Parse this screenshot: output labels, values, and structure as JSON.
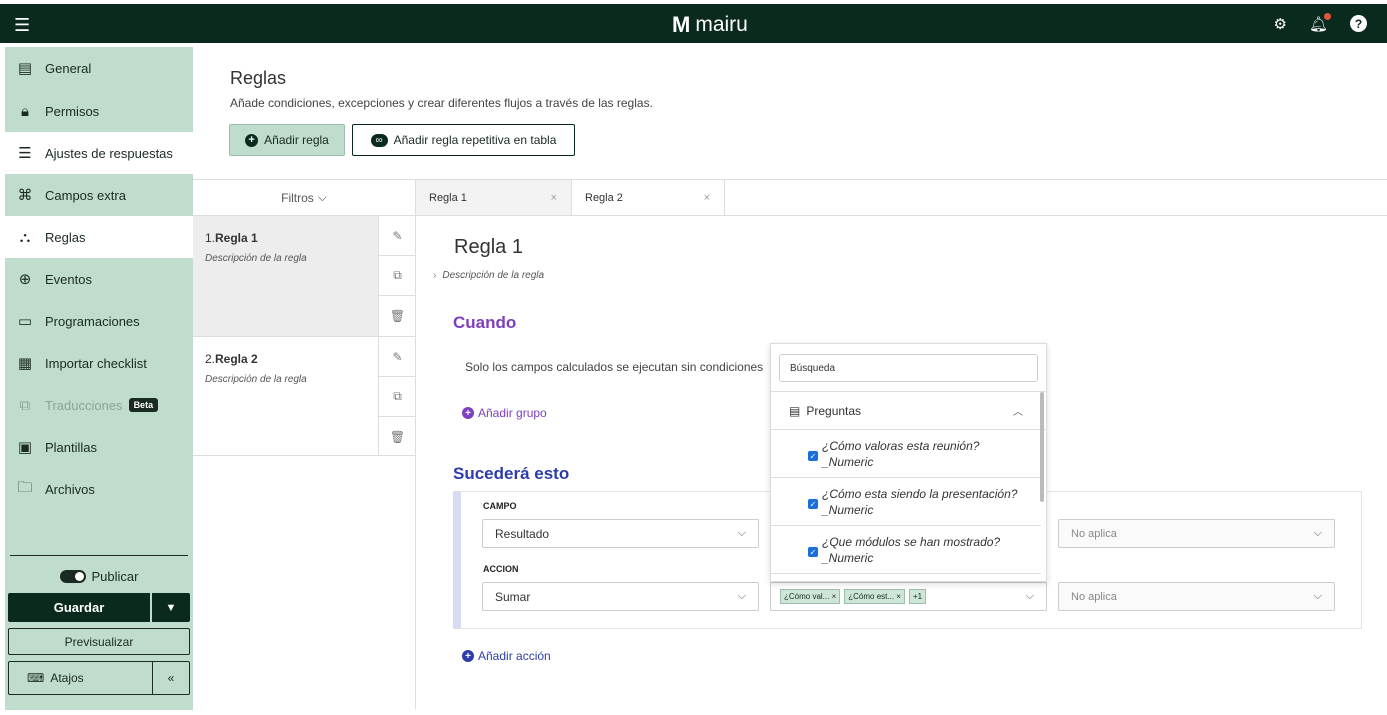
{
  "app": {
    "name": "mairu"
  },
  "sidebar": {
    "items": [
      {
        "label": "General",
        "icon": "document-icon"
      },
      {
        "label": "Permisos",
        "icon": "lock-icon"
      },
      {
        "label": "Ajustes de respuestas",
        "icon": "sliders-icon"
      },
      {
        "label": "Campos extra",
        "icon": "command-icon"
      },
      {
        "label": "Reglas",
        "icon": "hierarchy-icon"
      },
      {
        "label": "Eventos",
        "icon": "event-icon"
      },
      {
        "label": "Programaciones",
        "icon": "calendar-icon"
      },
      {
        "label": "Importar checklist",
        "icon": "calculator-icon"
      },
      {
        "label": "Traducciones",
        "icon": "translate-icon",
        "badge": "Beta"
      },
      {
        "label": "Plantillas",
        "icon": "template-icon"
      },
      {
        "label": "Archivos",
        "icon": "folder-icon"
      }
    ],
    "publish_label": "Publicar",
    "save_label": "Guardar",
    "preview_label": "Previsualizar",
    "shortcuts_label": "Atajos"
  },
  "header": {
    "title": "Reglas",
    "subtitle": "Añade condiciones, excepciones y crear diferentes flujos a través de las reglas.",
    "add_rule_label": "Añadir regla",
    "add_repeat_rule_label": "Añadir regla repetitiva en tabla"
  },
  "filters_label": "Filtros",
  "tabs": [
    {
      "label": "Regla 1"
    },
    {
      "label": "Regla 2"
    }
  ],
  "rules": [
    {
      "num": "1.",
      "name": "Regla 1",
      "description": "Descripción de la regla"
    },
    {
      "num": "2.",
      "name": "Regla 2",
      "description": "Descripción de la regla"
    }
  ],
  "editor": {
    "title": "Regla 1",
    "description": "Descripción de la regla",
    "when_heading": "Cuando",
    "when_text": "Solo los campos calculados se ejecutan sin condiciones",
    "add_group_label": "Añadir grupo",
    "then_heading": "Sucederá esto",
    "field_label": "CAMPO",
    "field_value": "Resultado",
    "action_label": "ACCION",
    "action_value": "Sumar",
    "chips": [
      "¿Cómo val...",
      "¿Cómo est...",
      "+1"
    ],
    "na_1": "No aplica",
    "na_2": "No aplica",
    "add_action_label": "Añadir acción"
  },
  "dropdown": {
    "search_value": "Búsqueda",
    "group_label": "Preguntas",
    "options": [
      {
        "line1": "¿Cómo valoras esta reunión?",
        "line2": "_Numeric",
        "checked": true
      },
      {
        "line1": "¿Cómo esta siendo la presentación?",
        "line2": "_Numeric",
        "checked": true
      },
      {
        "line1": "¿Que módulos se han mostrado?",
        "line2": "_Numeric",
        "checked": true
      }
    ]
  },
  "colors": {
    "brand_dark": "#0b2a1e",
    "sidebar_bg": "#bfdccd",
    "purple": "#7d3fc1",
    "blue": "#2d3eaa"
  }
}
